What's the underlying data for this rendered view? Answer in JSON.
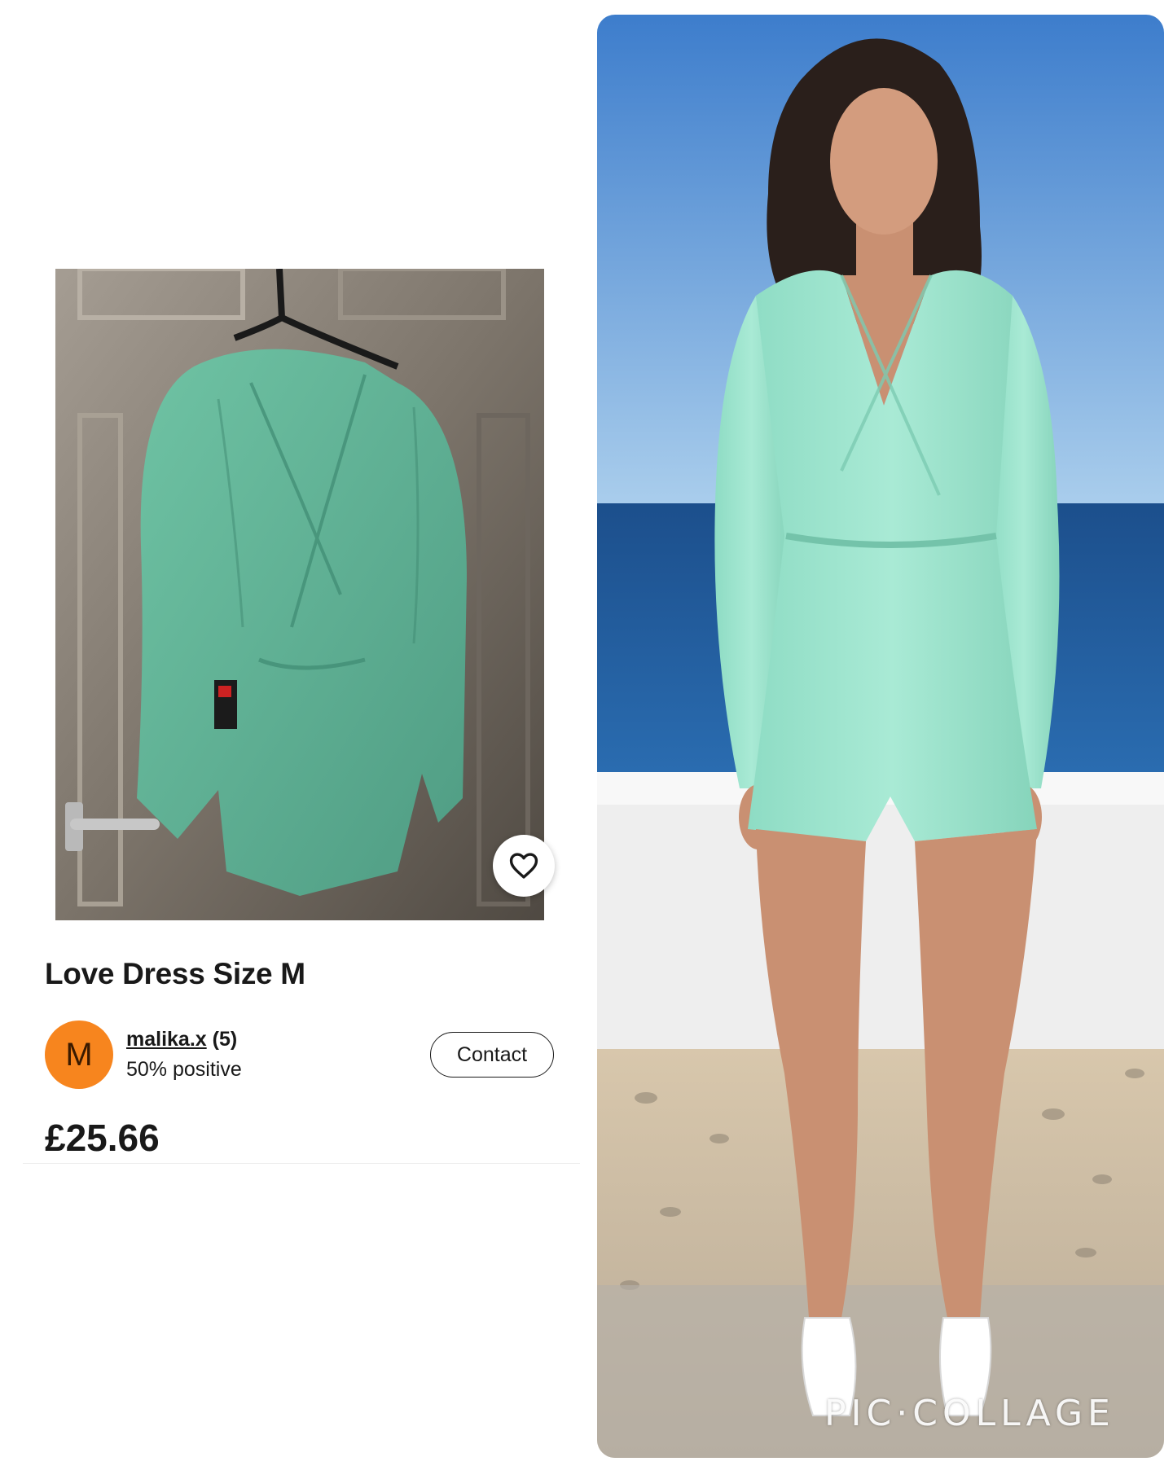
{
  "listing": {
    "title": "Love Dress Size M",
    "price": "£25.66",
    "favorite_icon": "heart-outline-icon"
  },
  "seller": {
    "avatar_initial": "M",
    "avatar_color": "#f7851e",
    "username": "malika.x",
    "feedback_count": "(5)",
    "feedback_percent": "50% positive",
    "contact_label": "Contact"
  },
  "collage": {
    "watermark": "PIC·COLLAGE"
  }
}
